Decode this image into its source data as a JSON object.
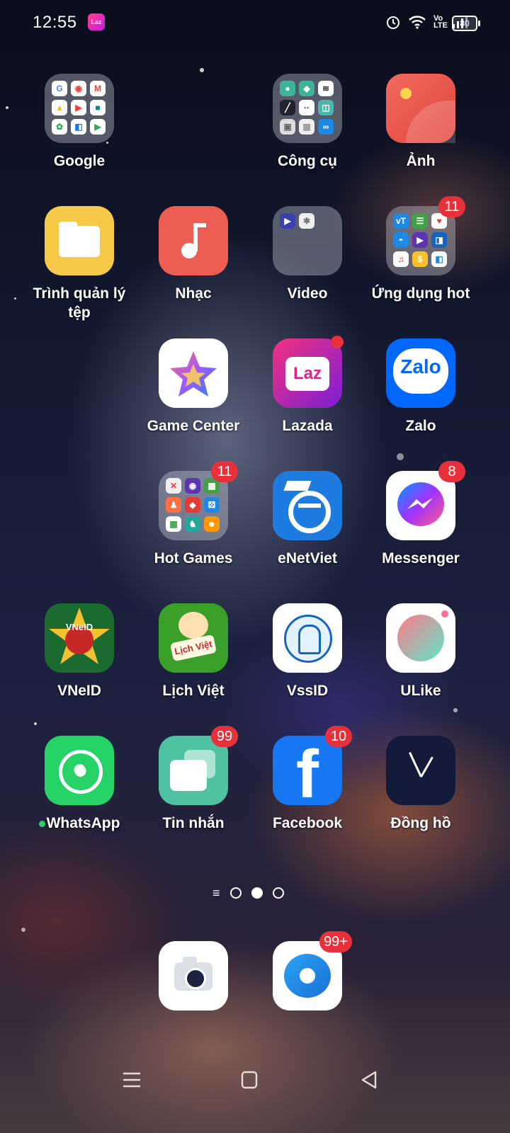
{
  "status": {
    "time": "12:55",
    "lazada_notif": "Laz",
    "volte": "Vo LTE",
    "battery": "80"
  },
  "apps": {
    "google": {
      "label": "Google"
    },
    "cong_cu": {
      "label": "Công cụ"
    },
    "anh": {
      "label": "Ảnh"
    },
    "trinh_quan_ly": {
      "label": "Trình quản lý tệp"
    },
    "nhac": {
      "label": "Nhạc"
    },
    "video": {
      "label": "Video"
    },
    "ung_dung_hot": {
      "label": "Ứng dụng hot",
      "badge": "11"
    },
    "game_center": {
      "label": "Game Center"
    },
    "lazada": {
      "label": "Lazada",
      "icon_text": "Laz"
    },
    "zalo": {
      "label": "Zalo",
      "icon_text": "Zalo"
    },
    "hot_games": {
      "label": "Hot Games",
      "badge": "11"
    },
    "enetviet": {
      "label": "eNetViet"
    },
    "messenger": {
      "label": "Messenger",
      "badge": "8"
    },
    "vneid": {
      "label": "VNeID",
      "icon_text": "VNeID"
    },
    "lich_viet": {
      "label": "Lịch Việt",
      "icon_text": "Lịch Việt"
    },
    "vssid": {
      "label": "VssID"
    },
    "ulike": {
      "label": "ULike"
    },
    "whatsapp": {
      "label": "WhatsApp"
    },
    "tin_nhan": {
      "label": "Tin nhắn",
      "badge": "99"
    },
    "facebook": {
      "label": "Facebook",
      "badge": "10",
      "icon_text": "f"
    },
    "dong_ho": {
      "label": "Đồng hồ"
    }
  },
  "dock": {
    "camera": {
      "label": "Camera"
    },
    "browser": {
      "label": "Browser",
      "badge": "99+"
    }
  },
  "colors": {
    "badge": "#e8303a",
    "facebook": "#1877f2",
    "zalo": "#0068ff",
    "whatsapp": "#25d366"
  }
}
